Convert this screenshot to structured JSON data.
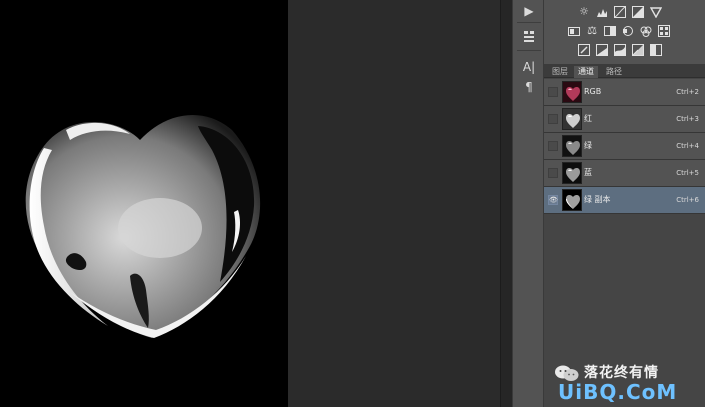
{
  "tabs": [
    {
      "label": "图层"
    },
    {
      "label": "通道"
    },
    {
      "label": "路径"
    }
  ],
  "channels": [
    {
      "name": "RGB",
      "shortcut": "Ctrl+2",
      "visible": false,
      "active": false
    },
    {
      "name": "红",
      "shortcut": "Ctrl+3",
      "visible": false,
      "active": false
    },
    {
      "name": "绿",
      "shortcut": "Ctrl+4",
      "visible": false,
      "active": false
    },
    {
      "name": "蓝",
      "shortcut": "Ctrl+5",
      "visible": false,
      "active": false
    },
    {
      "name": "绿 副本",
      "shortcut": "Ctrl+6",
      "visible": true,
      "active": true
    }
  ],
  "side_tools": {
    "play_glyph": "▶",
    "char_glyph": "A|",
    "para_glyph": "¶"
  },
  "watermark": {
    "author": "落花终有情",
    "site": "UiBQ.CoM"
  },
  "colors": {
    "panel_bg": "#535353",
    "active_row": "#5d6e80",
    "canvas": "#000000",
    "watermark_blue": "#6ec1ff"
  }
}
